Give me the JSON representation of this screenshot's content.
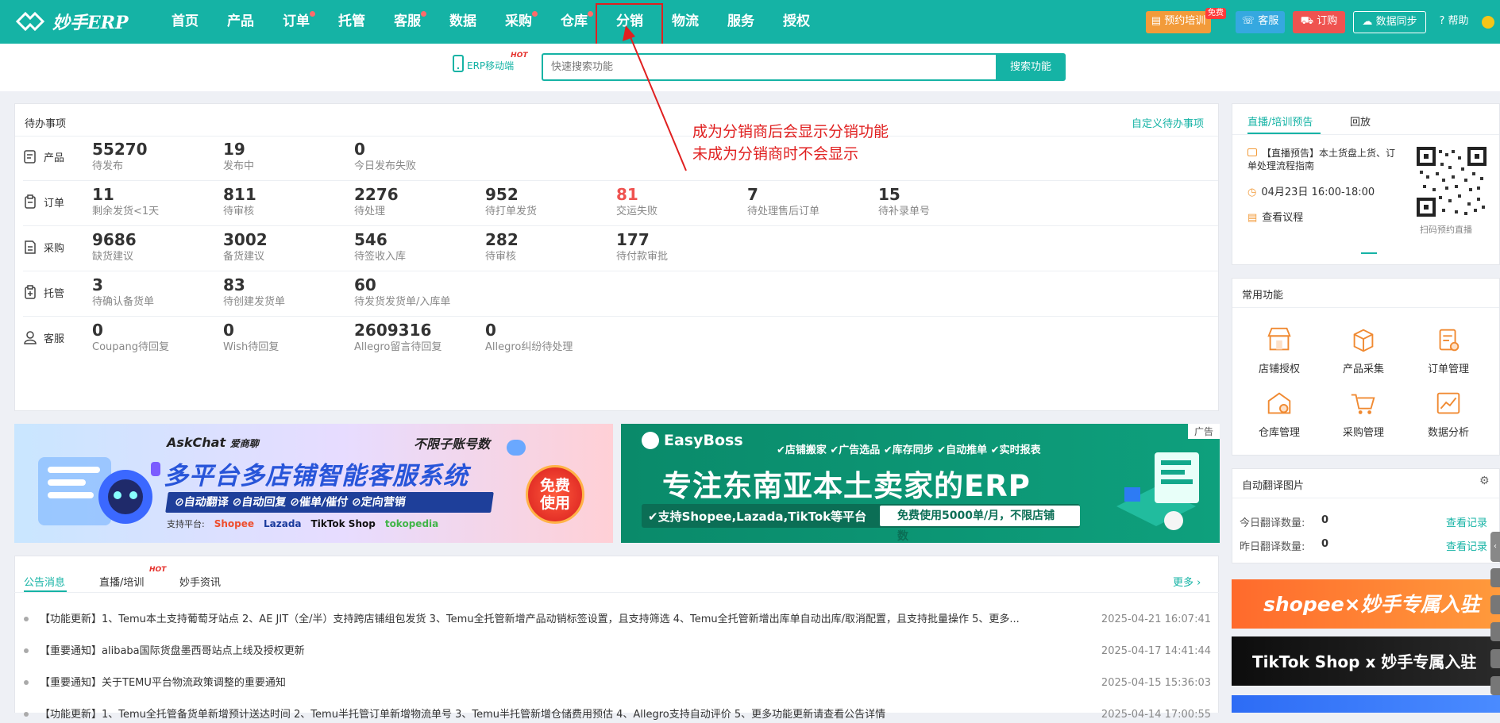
{
  "brand": {
    "name": "妙手ERP"
  },
  "nav": {
    "items": [
      {
        "label": "首页",
        "dot": false
      },
      {
        "label": "产品",
        "dot": false
      },
      {
        "label": "订单",
        "dot": true
      },
      {
        "label": "托管",
        "dot": false
      },
      {
        "label": "客服",
        "dot": true
      },
      {
        "label": "数据",
        "dot": false
      },
      {
        "label": "采购",
        "dot": true
      },
      {
        "label": "仓库",
        "dot": true
      },
      {
        "label": "分销",
        "dot": false
      },
      {
        "label": "物流",
        "dot": false
      },
      {
        "label": "服务",
        "dot": false
      },
      {
        "label": "授权",
        "dot": false
      }
    ],
    "highlighted": "分销"
  },
  "toolbar": {
    "training": "预约培训",
    "training_tag": "免费",
    "service": "客服",
    "order": "订购",
    "sync": "数据同步",
    "help": "帮助"
  },
  "search": {
    "mobile_label": "ERP移动端",
    "hot": "HOT",
    "placeholder": "快速搜索功能",
    "button": "搜索功能"
  },
  "annotation": {
    "line1": "成为分销商后会显示分销功能",
    "line2": "未成为分销商时不会显示"
  },
  "todo": {
    "title": "待办事项",
    "customize": "自定义待办事项",
    "rows": [
      {
        "label": "产品",
        "icon": "product-icon",
        "stats": [
          {
            "num": "55270",
            "label": "待发布"
          },
          {
            "num": "19",
            "label": "发布中"
          },
          {
            "num": "0",
            "label": "今日发布失败"
          }
        ]
      },
      {
        "label": "订单",
        "icon": "order-icon",
        "stats": [
          {
            "num": "11",
            "label": "剩余发货<1天"
          },
          {
            "num": "811",
            "label": "待审核"
          },
          {
            "num": "2276",
            "label": "待处理"
          },
          {
            "num": "952",
            "label": "待打单发货"
          },
          {
            "num": "81",
            "label": "交运失败",
            "red": true
          },
          {
            "num": "7",
            "label": "待处理售后订单"
          },
          {
            "num": "15",
            "label": "待补录单号"
          }
        ]
      },
      {
        "label": "采购",
        "icon": "purchase-icon",
        "stats": [
          {
            "num": "9686",
            "label": "缺货建议"
          },
          {
            "num": "3002",
            "label": "备货建议"
          },
          {
            "num": "546",
            "label": "待签收入库"
          },
          {
            "num": "282",
            "label": "待审核"
          },
          {
            "num": "177",
            "label": "待付款审批"
          }
        ]
      },
      {
        "label": "托管",
        "icon": "hosting-icon",
        "stats": [
          {
            "num": "3",
            "label": "待确认备货单"
          },
          {
            "num": "83",
            "label": "待创建发货单"
          },
          {
            "num": "60",
            "label": "待发货发货单/入库单"
          }
        ]
      },
      {
        "label": "客服",
        "icon": "service-icon",
        "stats": [
          {
            "num": "0",
            "label": "Coupang待回复"
          },
          {
            "num": "0",
            "label": "Wish待回复"
          },
          {
            "num": "2609316",
            "label": "Allegro留言待回复"
          },
          {
            "num": "0",
            "label": "Allegro纠纷待处理"
          }
        ]
      }
    ]
  },
  "banner1": {
    "brand": "AskChat",
    "brand_cn": "爱商聊",
    "tag": "不限子账号数",
    "headline": "多平台多店铺智能客服系统",
    "features": "⊘自动翻译 ⊘自动回复 ⊘催单/催付 ⊘定向营销",
    "platforms_label": "支持平台:",
    "platforms": [
      "Shopee",
      "Lazada",
      "TikTok Shop",
      "tokopedia"
    ],
    "badge": "免费使用"
  },
  "banner2": {
    "brand": "EasyBoss",
    "ad": "广告",
    "features": "✔店铺搬家 ✔广告选品 ✔库存同步 ✔自动推单 ✔实时报表",
    "headline": "专注东南亚本土卖家的ERP",
    "support": "✔支持Shopee,Lazada,TikTok等平台",
    "offer": "免费使用5000单/月，不限店铺数"
  },
  "news": {
    "tabs": [
      "公告消息",
      "直播/培训",
      "妙手资讯"
    ],
    "hot": "HOT",
    "more": "更多 ›",
    "items": [
      {
        "text": "【功能更新】1、Temu本土支持葡萄牙站点 2、AE JIT（全/半）支持跨店铺组包发货 3、Temu全托管新增产品动销标签设置，且支持筛选 4、Temu全托管新增出库单自动出库/取消配置，且支持批量操作 5、更多...",
        "date": "2025-04-21 16:07:41"
      },
      {
        "text": "【重要通知】alibaba国际货盘墨西哥站点上线及授权更新",
        "date": "2025-04-17 14:41:44"
      },
      {
        "text": "【重要通知】关于TEMU平台物流政策调整的重要通知",
        "date": "2025-04-15 15:36:03"
      },
      {
        "text": "【功能更新】1、Temu全托管备货单新增预计送达时间 2、Temu半托管订单新增物流单号 3、Temu半托管新增仓储费用预估 4、Allegro支持自动评价 5、更多功能更新请查看公告详情",
        "date": "2025-04-14 17:00:55"
      }
    ]
  },
  "live": {
    "tabs": [
      "直播/培训预告",
      "回放"
    ],
    "title": "【直播预告】本土货盘上货、订单处理流程指南",
    "time": "04月23日 16:00-18:00",
    "agenda": "查看议程",
    "qr_caption": "扫码预约直播"
  },
  "common": {
    "title": "常用功能",
    "items": [
      {
        "label": "店铺授权",
        "icon": "store-auth-icon"
      },
      {
        "label": "产品采集",
        "icon": "product-collect-icon"
      },
      {
        "label": "订单管理",
        "icon": "order-manage-icon"
      },
      {
        "label": "仓库管理",
        "icon": "warehouse-icon"
      },
      {
        "label": "采购管理",
        "icon": "purchase-cart-icon"
      },
      {
        "label": "数据分析",
        "icon": "data-analysis-icon"
      }
    ]
  },
  "translate": {
    "title": "自动翻译图片",
    "rows": [
      {
        "label": "今日翻译数量:",
        "value": "0",
        "link": "查看记录"
      },
      {
        "label": "昨日翻译数量:",
        "value": "0",
        "link": "查看记录"
      }
    ]
  },
  "promos": [
    {
      "text": "shopee×妙手专属入驻"
    },
    {
      "text": "TikTok Shop x 妙手专属入驻"
    }
  ],
  "colors": {
    "primary": "#15b3a5",
    "alert": "#e02020",
    "danger": "#ef5350"
  }
}
